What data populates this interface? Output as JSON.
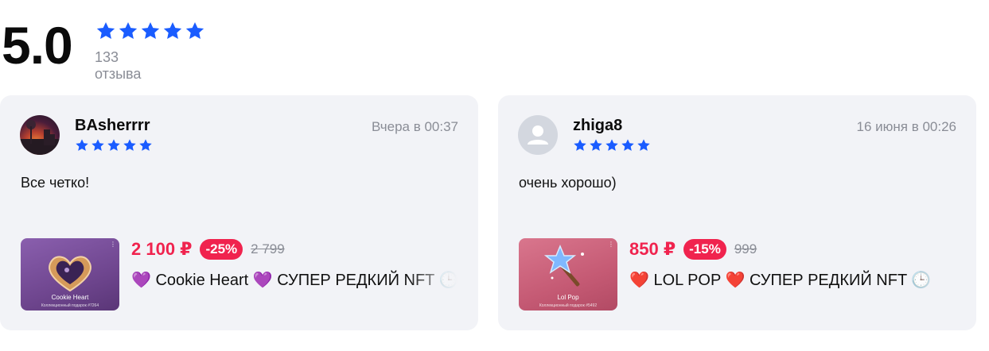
{
  "summary": {
    "rating": "5.0",
    "stars": 5,
    "review_count": "133 отзыва"
  },
  "colors": {
    "star": "#1a5cff",
    "price": "#f0234e",
    "muted": "#8a8d96",
    "card_bg": "#f2f3f7"
  },
  "reviews": [
    {
      "author": "BAsherrrr",
      "date": "Вчера в 00:37",
      "stars": 5,
      "text": "Все четко!",
      "avatar": "photo-avatar",
      "product": {
        "price": "2 100 ₽",
        "discount": "-25%",
        "old_price": "2 799",
        "name_emoji": "💜",
        "name": "Cookie Heart",
        "tag": "СУПЕР РЕДКИЙ NFT",
        "thumb_title": "Cookie Heart",
        "thumb_sub": "Коллекционный подарок #7264"
      }
    },
    {
      "author": "zhiga8",
      "date": "16 июня в 00:26",
      "stars": 5,
      "text": "очень хорошо)",
      "avatar": "placeholder-avatar",
      "product": {
        "price": "850 ₽",
        "discount": "-15%",
        "old_price": "999",
        "name_emoji": "❤️",
        "name": "LOL POP",
        "tag": "СУПЕР РЕДКИЙ NFT",
        "thumb_title": "Lol Pop",
        "thumb_sub": "Коллекционный подарок #5492"
      }
    }
  ]
}
